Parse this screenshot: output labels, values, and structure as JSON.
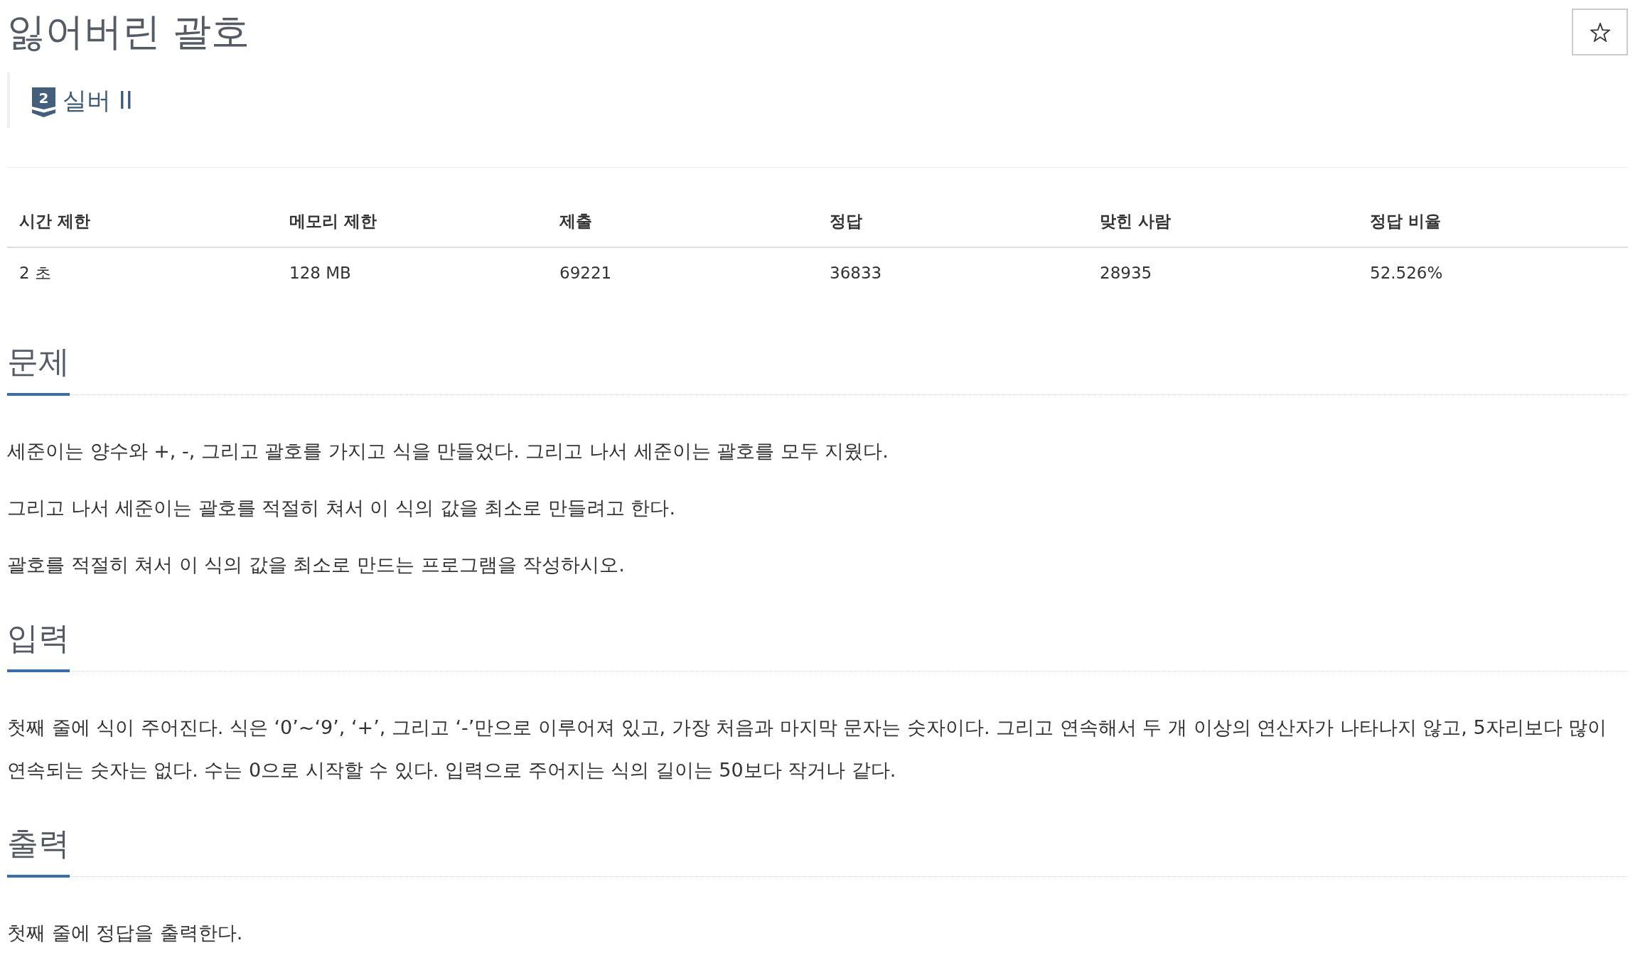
{
  "title": "잃어버린 괄호",
  "favorite_button": {
    "starred": false
  },
  "tier": {
    "badge": "2",
    "label": "실버 II"
  },
  "stats": {
    "columns": [
      "시간 제한",
      "메모리 제한",
      "제출",
      "정답",
      "맞힌 사람",
      "정답 비율"
    ],
    "rows": [
      [
        "2 초",
        "128 MB",
        "69221",
        "36833",
        "28935",
        "52.526%"
      ]
    ]
  },
  "sections": [
    {
      "heading": "문제",
      "paragraphs": [
        "세준이는 양수와 +, -, 그리고 괄호를 가지고 식을 만들었다. 그리고 나서 세준이는 괄호를 모두 지웠다.",
        "그리고 나서 세준이는 괄호를 적절히 쳐서 이 식의 값을 최소로 만들려고 한다.",
        "괄호를 적절히 쳐서 이 식의 값을 최소로 만드는 프로그램을 작성하시오."
      ]
    },
    {
      "heading": "입력",
      "paragraphs": [
        "첫째 줄에 식이 주어진다. 식은 ‘0’~‘9’, ‘+’, 그리고 ‘-’만으로 이루어져 있고, 가장 처음과 마지막 문자는 숫자이다. 그리고 연속해서 두 개 이상의 연산자가 나타나지 않고, 5자리보다 많이 연속되는 숫자는 없다. 수는 0으로 시작할 수 있다. 입력으로 주어지는 식의 길이는 50보다 작거나 같다."
      ]
    },
    {
      "heading": "출력",
      "paragraphs": [
        "첫째 줄에 정답을 출력한다."
      ]
    }
  ]
}
